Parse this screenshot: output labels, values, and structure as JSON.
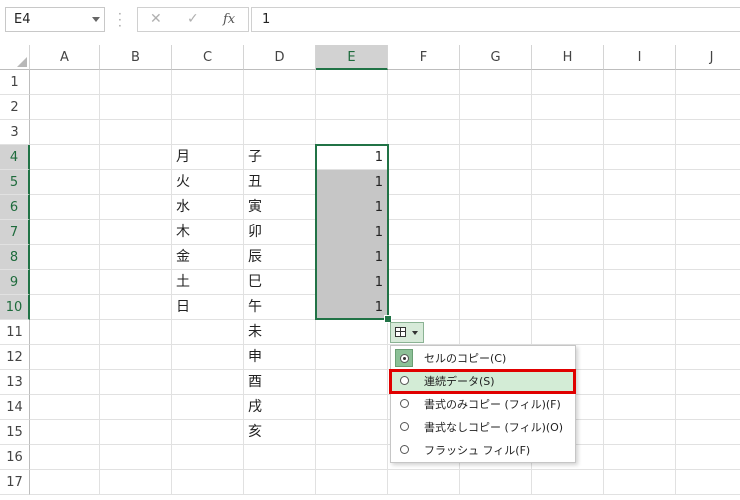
{
  "formula_bar": {
    "name_box": "E4",
    "cancel_icon": "✕",
    "enter_icon": "✓",
    "fx_label": "fx",
    "formula": "1"
  },
  "columns": [
    "A",
    "B",
    "C",
    "D",
    "E",
    "F",
    "G",
    "H",
    "I",
    "J"
  ],
  "rows": [
    "1",
    "2",
    "3",
    "4",
    "5",
    "6",
    "7",
    "8",
    "9",
    "10",
    "11",
    "12",
    "13",
    "14",
    "15",
    "16",
    "17"
  ],
  "selected_column": "E",
  "selected_rows": [
    "4",
    "5",
    "6",
    "7",
    "8",
    "9",
    "10"
  ],
  "cells": {
    "C": [
      "月",
      "火",
      "水",
      "木",
      "金",
      "土",
      "日"
    ],
    "D": [
      "子",
      "丑",
      "寅",
      "卯",
      "辰",
      "巳",
      "午",
      "未",
      "申",
      "酉",
      "戌",
      "亥"
    ],
    "E": [
      "1",
      "1",
      "1",
      "1",
      "1",
      "1",
      "1"
    ]
  },
  "autofill_menu": {
    "items": [
      {
        "label": "セルのコピー(C)",
        "checked": true
      },
      {
        "label": "連続データ(S)",
        "checked": false
      },
      {
        "label": "書式のみコピー (フィル)(F)",
        "checked": false
      },
      {
        "label": "書式なしコピー (フィル)(O)",
        "checked": false
      },
      {
        "label": "フラッシュ フィル(F)",
        "checked": false
      }
    ],
    "highlighted_index": 1
  },
  "colors": {
    "accent": "#217346",
    "selection_fill": "#c6c6c6",
    "highlight_box": "#e00000"
  }
}
